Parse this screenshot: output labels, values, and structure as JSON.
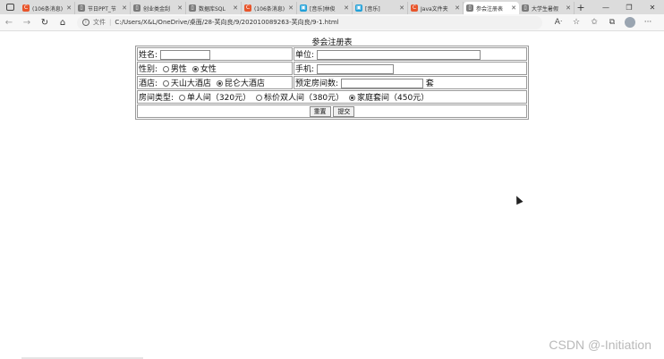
{
  "browser": {
    "tabs": [
      {
        "title": "(106条消息)",
        "favicon_color": "#e8552b",
        "favicon_glyph": "C",
        "active": false
      },
      {
        "title": "节日PPT_节",
        "favicon_color": "#7a7a7a",
        "favicon_glyph": "▯",
        "active": false
      },
      {
        "title": "创业类金刮",
        "favicon_color": "#7a7a7a",
        "favicon_glyph": "▯",
        "active": false
      },
      {
        "title": "数据库SQL",
        "favicon_color": "#7a7a7a",
        "favicon_glyph": "▯",
        "active": false
      },
      {
        "title": "(106条消息)",
        "favicon_color": "#e8552b",
        "favicon_glyph": "C",
        "active": false
      },
      {
        "title": "[音乐]林俊",
        "favicon_color": "#20a0d8",
        "favicon_glyph": "▣",
        "active": false
      },
      {
        "title": "[音乐]",
        "favicon_color": "#20a0d8",
        "favicon_glyph": "▣",
        "active": false
      },
      {
        "title": "Java文件夹",
        "favicon_color": "#e8552b",
        "favicon_glyph": "C",
        "active": false
      },
      {
        "title": "参会注册表",
        "favicon_color": "#7a7a7a",
        "favicon_glyph": "▯",
        "active": true
      },
      {
        "title": "大学生暑假",
        "favicon_color": "#7a7a7a",
        "favicon_glyph": "▯",
        "active": false
      }
    ],
    "address": {
      "scheme_label": "文件",
      "url": "C:/Users/X&L/OneDrive/桌面/28-芙向良/9/202010089263-芙向良/9-1.html"
    }
  },
  "page": {
    "title": "参会注册表",
    "labels": {
      "name": "姓名:",
      "unit": "单位:",
      "gender": "性别:",
      "phone": "手机:",
      "hotel": "酒店:",
      "rooms": "预定房间数:",
      "rooms_suffix": "套",
      "room_type": "房间类型:"
    },
    "gender_options": [
      {
        "label": "男性",
        "checked": false
      },
      {
        "label": "女性",
        "checked": true
      }
    ],
    "hotel_options": [
      {
        "label": "天山大酒店",
        "checked": false
      },
      {
        "label": "昆仑大酒店",
        "checked": true
      }
    ],
    "room_type_options": [
      {
        "label": "单人间（320元）",
        "checked": false
      },
      {
        "label": "标价双人间（380元）",
        "checked": false
      },
      {
        "label": "家庭套间（450元）",
        "checked": true
      }
    ],
    "buttons": {
      "reset": "重置",
      "submit": "提交"
    },
    "watermark": "CSDN @-Initiation"
  }
}
